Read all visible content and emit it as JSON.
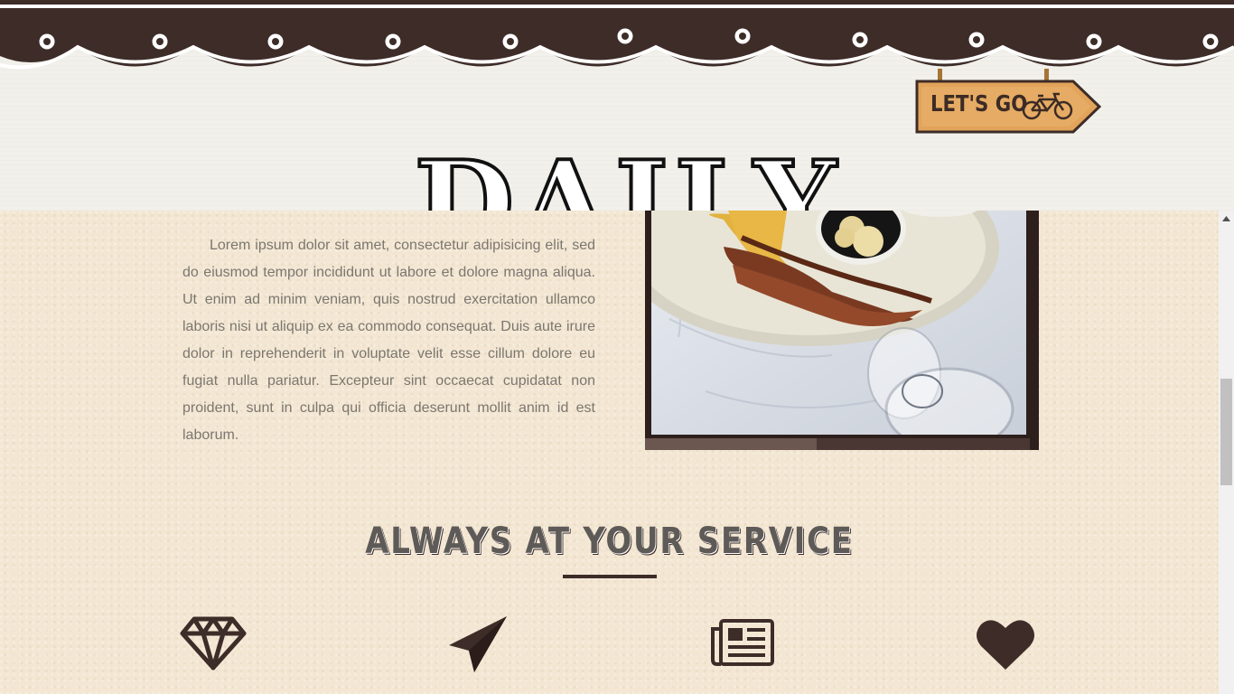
{
  "header": {
    "sign_label": "LET'S GO",
    "big_word": "DAILY"
  },
  "about": {
    "paragraph": "Lorem ipsum dolor sit amet, consectetur adipisicing elit, sed do eiusmod tempor incididunt ut labore et dolore magna aliqua. Ut enim ad minim veniam, quis nostrud exercitation ullamco laboris nisi ut aliquip ex ea commodo consequat. Duis aute irure dolor in reprehenderit in voluptate velit esse cillum dolore eu fugiat nulla pariatur. Excepteur sint occaecat cupidatat non proident, sunt in culpa qui officia deserunt mollit anim id est laborum."
  },
  "services": {
    "title": "ALWAYS AT YOUR SERVICE",
    "icons": [
      "diamond-icon",
      "paper-plane-icon",
      "newspaper-icon",
      "heart-icon"
    ]
  },
  "colors": {
    "brand_dark": "#3d2c28",
    "background_paper": "#f3e7d3",
    "text_muted": "#7c766f"
  }
}
